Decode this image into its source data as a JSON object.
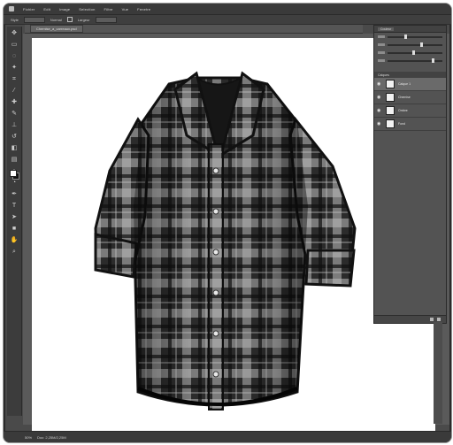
{
  "menu": {
    "items": [
      "Fichier",
      "Edit",
      "Image",
      "Selection",
      "Filtre",
      "Vue",
      "Fenetre"
    ]
  },
  "options": {
    "opt1": "Style",
    "opt2": "Normal",
    "opt3": "Largeur"
  },
  "document": {
    "tab_label": "Chemise_a_carreaux.psd"
  },
  "panels": {
    "tabs": [
      "Couleur",
      "Calques"
    ],
    "layers_header": "Calques",
    "layers": [
      {
        "name": "Calque 1",
        "selected": true
      },
      {
        "name": "Chemise",
        "selected": false
      },
      {
        "name": "Ombre",
        "selected": false
      },
      {
        "name": "Fond",
        "selected": false
      }
    ]
  },
  "status": {
    "zoom": "50%",
    "doc_info": "Doc: 2,25M/2,25M"
  },
  "shirt": {
    "base_color": "#2b2b2b",
    "check_light": "#bdbdbd",
    "check_dark": "#0f0f0f",
    "button_color": "#e8e8e8"
  },
  "colors": {
    "foreground": "#ffffff",
    "background": "#111111",
    "canvas": "#ffffff",
    "ui_dark": "#3a3a3a"
  }
}
